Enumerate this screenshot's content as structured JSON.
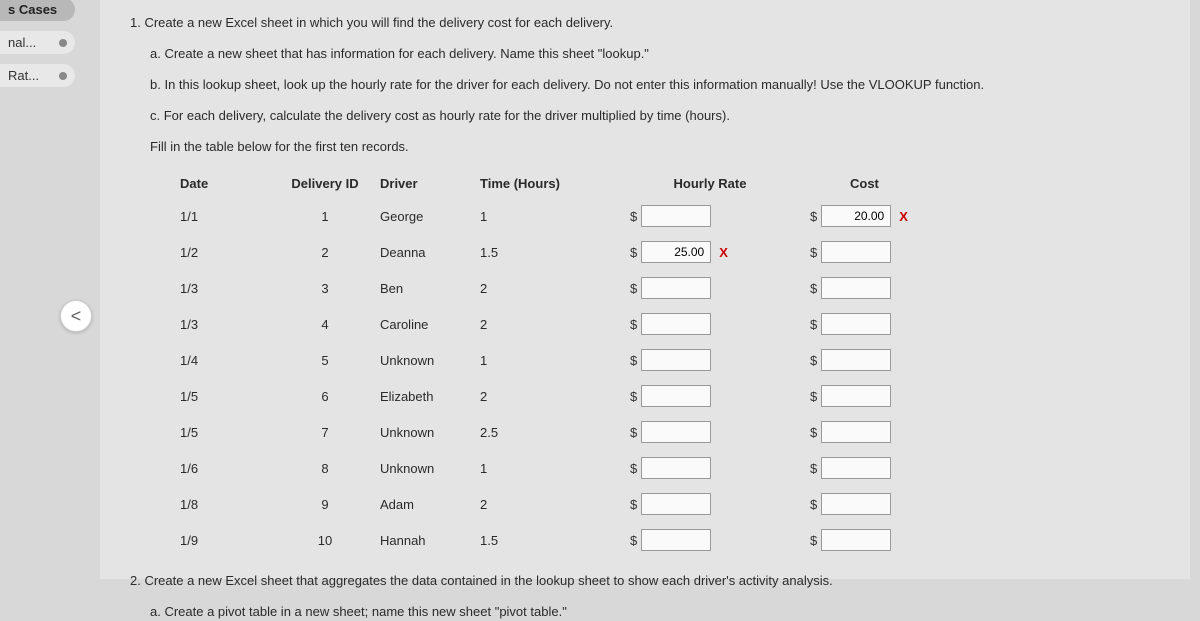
{
  "nav": {
    "tab1": "s Cases",
    "tab2": "nal...",
    "tab3": "Rat..."
  },
  "prev_icon": "<",
  "instructions": {
    "main1": "1. Create a new Excel sheet in which you will find the delivery cost for each delivery.",
    "sub_a": "a. Create a new sheet that has information for each delivery. Name this sheet \"lookup.\"",
    "sub_b": "b. In this lookup sheet, look up the hourly rate for the driver for each delivery. Do not enter this information manually! Use the VLOOKUP function.",
    "sub_c": "c. For each delivery, calculate the delivery cost as hourly rate for the driver multiplied by time (hours).",
    "fill": "Fill in the table below for the first ten records.",
    "main2": "2. Create a new Excel sheet that aggregates the data contained in the lookup sheet to show each driver's activity analysis.",
    "sub2_a": "a. Create a pivot table in a new sheet; name this new sheet \"pivot table.\""
  },
  "table": {
    "headers": {
      "date": "Date",
      "id": "Delivery ID",
      "driver": "Driver",
      "time": "Time (Hours)",
      "rate": "Hourly Rate",
      "cost": "Cost"
    },
    "rows": [
      {
        "date": "1/1",
        "id": "1",
        "driver": "George",
        "time": "1",
        "rate": "",
        "rate_wrong": false,
        "cost": "20.00",
        "cost_wrong": true
      },
      {
        "date": "1/2",
        "id": "2",
        "driver": "Deanna",
        "time": "1.5",
        "rate": "25.00",
        "rate_wrong": true,
        "cost": "",
        "cost_wrong": false
      },
      {
        "date": "1/3",
        "id": "3",
        "driver": "Ben",
        "time": "2",
        "rate": "",
        "rate_wrong": false,
        "cost": "",
        "cost_wrong": false
      },
      {
        "date": "1/3",
        "id": "4",
        "driver": "Caroline",
        "time": "2",
        "rate": "",
        "rate_wrong": false,
        "cost": "",
        "cost_wrong": false
      },
      {
        "date": "1/4",
        "id": "5",
        "driver": "Unknown",
        "time": "1",
        "rate": "",
        "rate_wrong": false,
        "cost": "",
        "cost_wrong": false
      },
      {
        "date": "1/5",
        "id": "6",
        "driver": "Elizabeth",
        "time": "2",
        "rate": "",
        "rate_wrong": false,
        "cost": "",
        "cost_wrong": false
      },
      {
        "date": "1/5",
        "id": "7",
        "driver": "Unknown",
        "time": "2.5",
        "rate": "",
        "rate_wrong": false,
        "cost": "",
        "cost_wrong": false
      },
      {
        "date": "1/6",
        "id": "8",
        "driver": "Unknown",
        "time": "1",
        "rate": "",
        "rate_wrong": false,
        "cost": "",
        "cost_wrong": false
      },
      {
        "date": "1/8",
        "id": "9",
        "driver": "Adam",
        "time": "2",
        "rate": "",
        "rate_wrong": false,
        "cost": "",
        "cost_wrong": false
      },
      {
        "date": "1/9",
        "id": "10",
        "driver": "Hannah",
        "time": "1.5",
        "rate": "",
        "rate_wrong": false,
        "cost": "",
        "cost_wrong": false
      }
    ]
  },
  "currency": "$",
  "wrong_mark": "X"
}
